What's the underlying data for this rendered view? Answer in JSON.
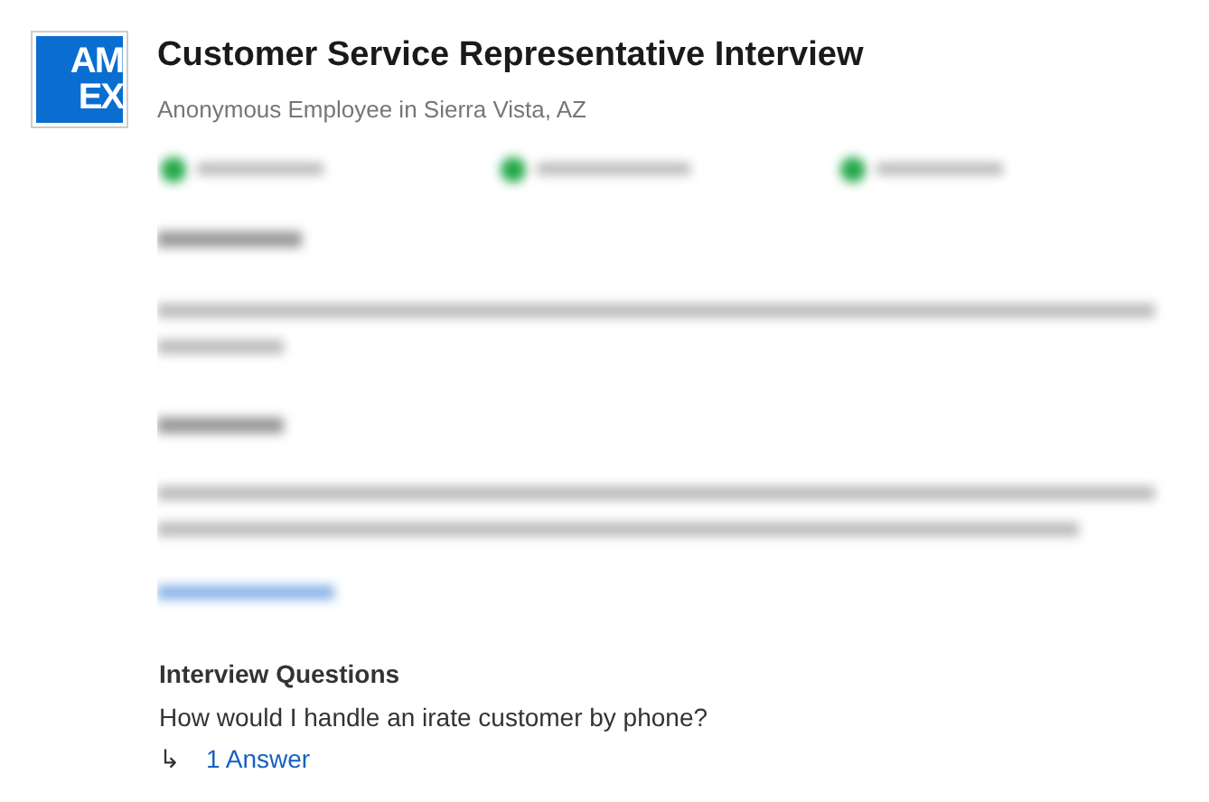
{
  "logo": {
    "lines": [
      "AM",
      "EX"
    ]
  },
  "title": "Customer Service Representative Interview",
  "subtitle": "Anonymous Employee in Sierra Vista, AZ",
  "questions_section": {
    "heading": "Interview Questions",
    "questions": [
      {
        "text": "How would I handle an irate customer by phone?",
        "arrow": "↳",
        "answers": "1 Answer"
      }
    ]
  }
}
